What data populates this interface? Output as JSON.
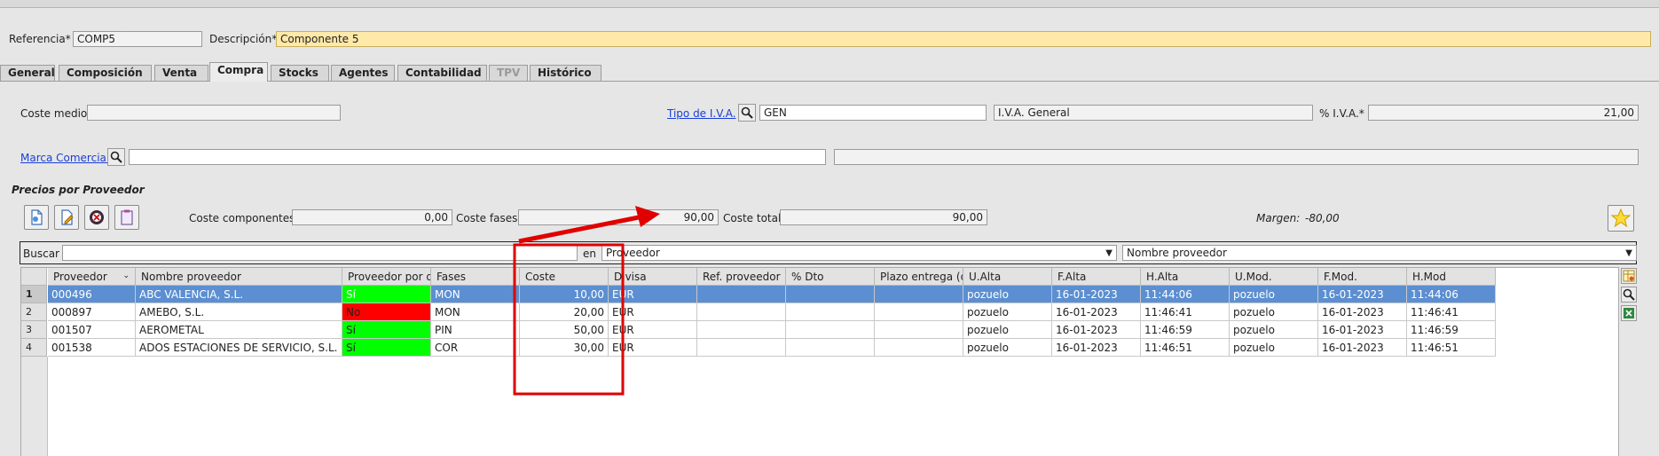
{
  "header": {
    "referencia_label": "Referencia*",
    "referencia_value": "COMP5",
    "descripcion_label": "Descripción*",
    "descripcion_value": "Componente 5"
  },
  "tabs": [
    {
      "label": "General"
    },
    {
      "label": "Composición"
    },
    {
      "label": "Venta"
    },
    {
      "label": "Compra"
    },
    {
      "label": "Stocks"
    },
    {
      "label": "Agentes"
    },
    {
      "label": "Contabilidad"
    },
    {
      "label": "TPV"
    },
    {
      "label": "Histórico"
    }
  ],
  "compra": {
    "coste_medio_label": "Coste medio",
    "coste_medio_value": "",
    "tipo_iva_label": "Tipo de I.V.A.",
    "tipo_iva_code": "GEN",
    "tipo_iva_desc": "I.V.A. General",
    "pct_iva_label": "% I.V.A.*",
    "pct_iva_value": "21,00",
    "marca_label": "Marca Comercial",
    "marca_value": "",
    "marca_desc": ""
  },
  "precios": {
    "title": "Precios por Proveedor",
    "coste_componentes_label": "Coste componentes",
    "coste_componentes_value": "0,00",
    "coste_fases_label": "Coste fases",
    "coste_fases_value": "90,00",
    "coste_total_label": "Coste total",
    "coste_total_value": "90,00",
    "margen_label": "Margen:",
    "margen_value": "-80,00"
  },
  "search": {
    "label": "Buscar",
    "value": "",
    "en_label": "en",
    "field1": "Proveedor",
    "field2": "Nombre proveedor"
  },
  "table": {
    "columns": [
      "Proveedor",
      "Nombre proveedor",
      "Proveedor por d",
      "Fases",
      "Coste",
      "Divisa",
      "Ref. proveedor",
      "% Dto",
      "Plazo entrega (d",
      "U.Alta",
      "F.Alta",
      "H.Alta",
      "U.Mod.",
      "F.Mod.",
      "H.Mod"
    ],
    "rows": [
      {
        "num": "1",
        "cells": [
          "000496",
          "ABC VALENCIA, S.L.",
          "Sí",
          "MON",
          "10,00",
          "EUR",
          "",
          "",
          "",
          "pozuelo",
          "16-01-2023",
          "11:44:06",
          "pozuelo",
          "16-01-2023",
          "11:44:06"
        ]
      },
      {
        "num": "2",
        "cells": [
          "000897",
          "AMEBO, S.L.",
          "No",
          "MON",
          "20,00",
          "EUR",
          "",
          "",
          "",
          "pozuelo",
          "16-01-2023",
          "11:46:41",
          "pozuelo",
          "16-01-2023",
          "11:46:41"
        ]
      },
      {
        "num": "3",
        "cells": [
          "001507",
          "AEROMETAL",
          "Sí",
          "PIN",
          "50,00",
          "EUR",
          "",
          "",
          "",
          "pozuelo",
          "16-01-2023",
          "11:46:59",
          "pozuelo",
          "16-01-2023",
          "11:46:59"
        ]
      },
      {
        "num": "4",
        "cells": [
          "001538",
          "ADOS ESTACIONES DE SERVICIO, S.L.",
          "Sí",
          "COR",
          "30,00",
          "EUR",
          "",
          "",
          "",
          "pozuelo",
          "16-01-2023",
          "11:46:51",
          "pozuelo",
          "16-01-2023",
          "11:46:51"
        ]
      }
    ]
  },
  "colors": {
    "yes": "#00ff00",
    "no": "#ff0000",
    "selected_row": "#5b8fd1",
    "annotation": "#e00000"
  }
}
